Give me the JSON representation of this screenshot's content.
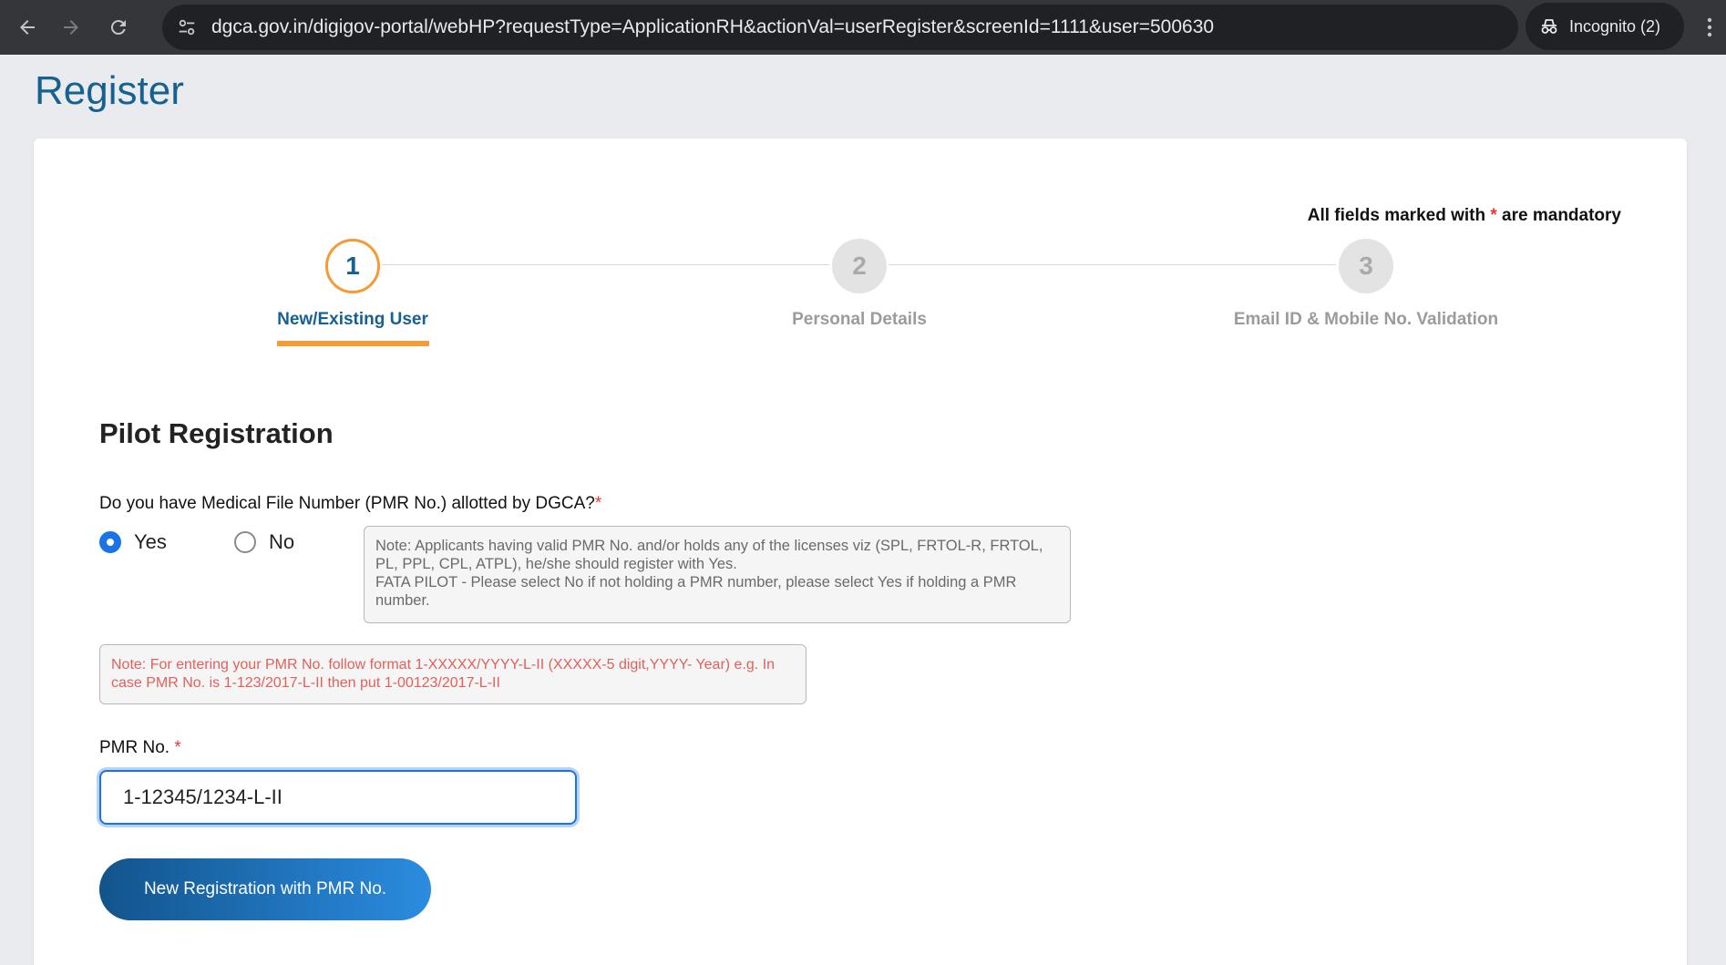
{
  "browser": {
    "url": "dgca.gov.in/digigov-portal/webHP?requestType=ApplicationRH&actionVal=userRegister&screenId=1111&user=500630",
    "incognito_label": "Incognito (2)"
  },
  "page": {
    "title": "Register"
  },
  "card": {
    "mandatory_prefix": "All fields marked with",
    "mandatory_asterisk": "*",
    "mandatory_suffix": "are mandatory",
    "steps": [
      {
        "number": "1",
        "label": "New/Existing User",
        "state": "active"
      },
      {
        "number": "2",
        "label": "Personal Details",
        "state": "inactive"
      },
      {
        "number": "3",
        "label": "Email ID & Mobile No. Validation",
        "state": "inactive"
      }
    ],
    "section_title": "Pilot Registration",
    "question": "Do you have Medical File Number (PMR No.) allotted by DGCA?",
    "question_asterisk": "*",
    "radio_yes": "Yes",
    "radio_no": "No",
    "radio_selected": "Yes",
    "note_gray_line1": "Note: Applicants having valid PMR No. and/or holds any of the licenses viz (SPL, FRTOL-R, FRTOL, PL, PPL, CPL, ATPL), he/she should register with Yes.",
    "note_gray_line2": "FATA PILOT - Please select No if not holding a PMR number, please select Yes if holding a PMR number.",
    "note_red": "Note: For entering your PMR No. follow format 1-XXXXX/YYYY-L-II (XXXXX-5 digit,YYYY- Year) e.g. In case PMR No. is 1-123/2017-L-II then put 1-00123/2017-L-II",
    "pmr_label": "PMR No.",
    "pmr_asterisk": "*",
    "pmr_value": "1-12345/1234-L-II",
    "register_button": "New Registration with PMR No."
  },
  "colors": {
    "accent_blue": "#16618f",
    "step_orange": "#f59a36",
    "required_red": "#e53935",
    "note_red_text": "#e2605a"
  },
  "icons": [
    "back-arrow-icon",
    "forward-arrow-icon",
    "reload-icon",
    "site-info-icon",
    "bookmark-star-icon",
    "incognito-icon",
    "more-menu-icon"
  ]
}
